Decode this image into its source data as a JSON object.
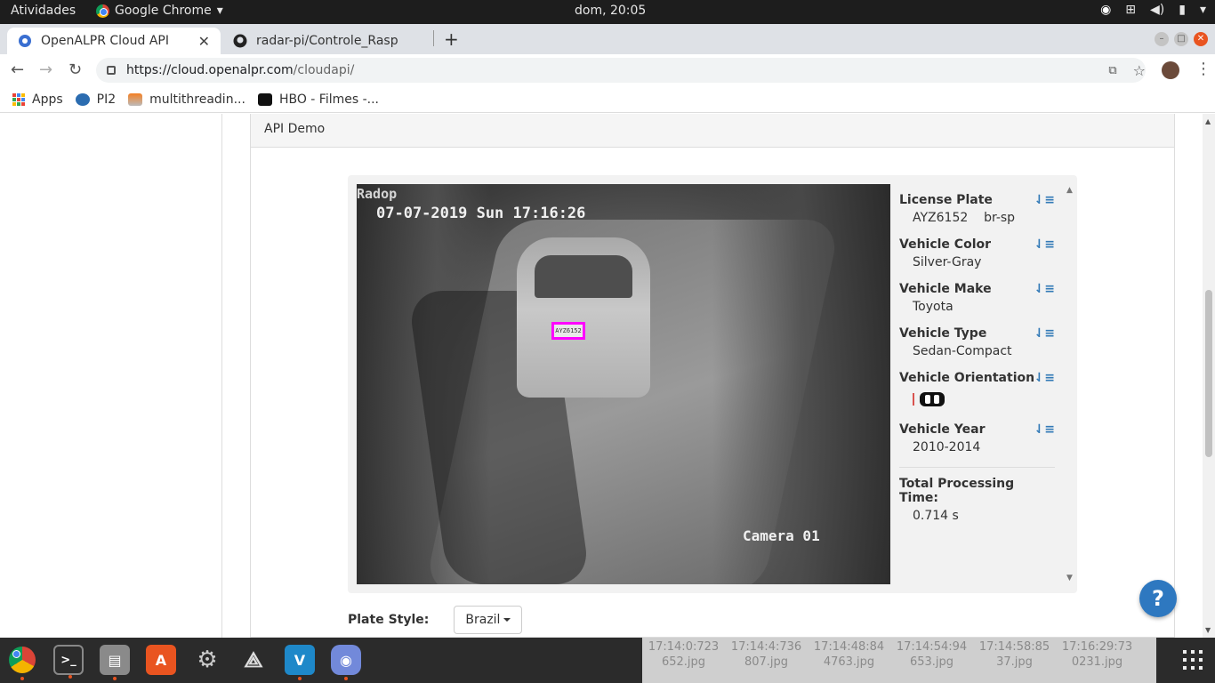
{
  "topbar": {
    "activities": "Atividades",
    "app_name": "Google Chrome",
    "clock": "dom, 20:05"
  },
  "tabs": [
    {
      "label": "OpenALPR Cloud API",
      "active": true
    },
    {
      "label": "radar-pi/Controle_Rasp",
      "active": false
    }
  ],
  "address": {
    "url_host": "https://cloud.openalpr.com",
    "url_path": "/cloudapi/"
  },
  "bookmarks": [
    {
      "label": "Apps"
    },
    {
      "label": "PI2"
    },
    {
      "label": "multithreadin..."
    },
    {
      "label": "HBO - Filmes -..."
    }
  ],
  "panel": {
    "heading": "API Demo"
  },
  "camera": {
    "brand": "Radop",
    "timestamp": "07-07-2019 Sun 17:16:26",
    "camera_name": "Camera 01",
    "plate_text": "AYZ6152"
  },
  "results": {
    "license_plate": {
      "label": "License Plate",
      "plate": "AYZ6152",
      "region": "br-sp"
    },
    "vehicle_color": {
      "label": "Vehicle Color",
      "value": "Silver-Gray"
    },
    "vehicle_make": {
      "label": "Vehicle Make",
      "value": "Toyota"
    },
    "vehicle_type": {
      "label": "Vehicle Type",
      "value": "Sedan-Compact"
    },
    "vehicle_orientation": {
      "label": "Vehicle Orientation"
    },
    "vehicle_year": {
      "label": "Vehicle Year",
      "value": "2010-2014"
    },
    "processing": {
      "label": "Total Processing Time:",
      "value": "0.714 s"
    }
  },
  "plate_style": {
    "label": "Plate Style:",
    "selected": "Brazil"
  },
  "help": {
    "label": "?"
  },
  "dock_thumbs": [
    {
      "line1": "17:14:0:723",
      "line2": "652.jpg"
    },
    {
      "line1": "17:14:4:736",
      "line2": "807.jpg"
    },
    {
      "line1": "17:14:48:84",
      "line2": "4763.jpg"
    },
    {
      "line1": "17:14:54:94",
      "line2": "653.jpg"
    },
    {
      "line1": "17:14:58:85",
      "line2": "37.jpg"
    },
    {
      "line1": "17:16:29:73",
      "line2": "0231.jpg"
    }
  ],
  "colors": {
    "plate_highlight": "#ff00ff",
    "help_button": "#2e78c0",
    "sort_icon": "#337ab7",
    "ubuntu_orange": "#e95420"
  }
}
